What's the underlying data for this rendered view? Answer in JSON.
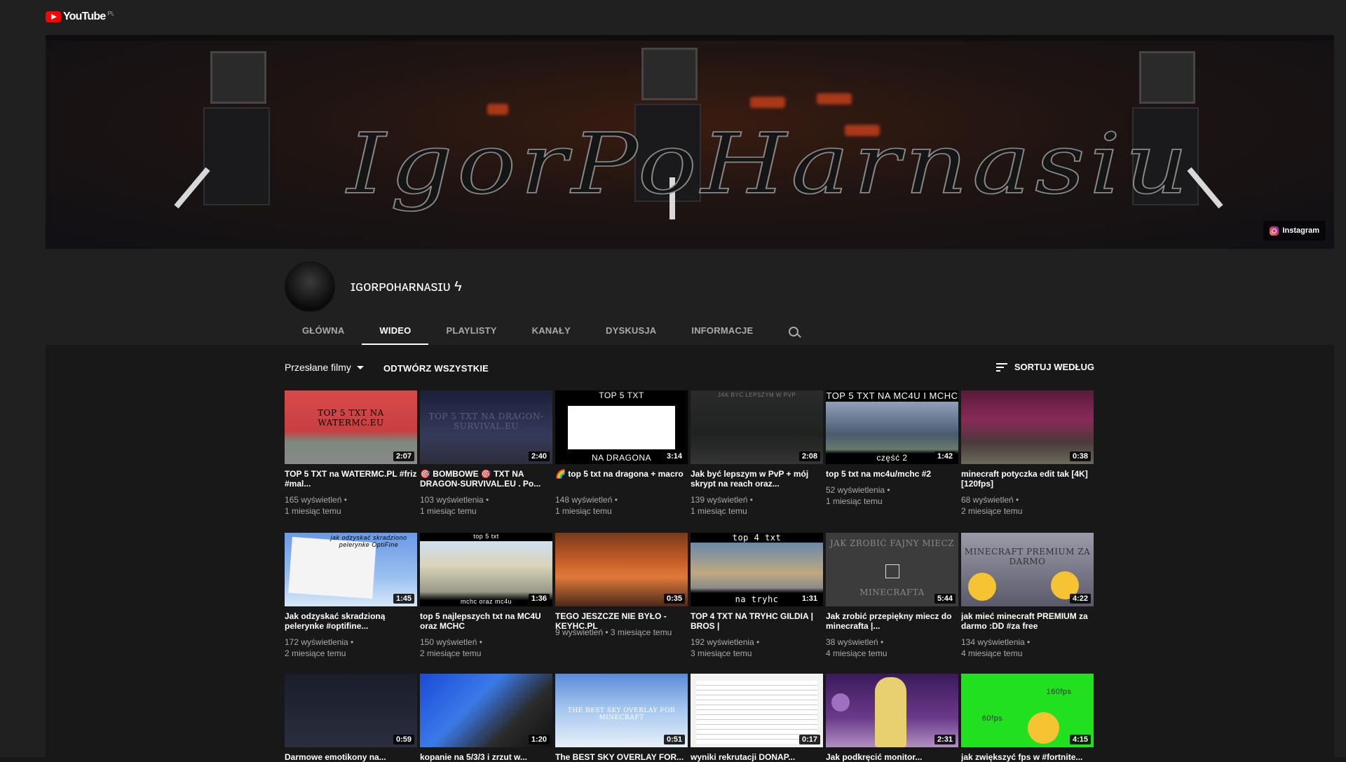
{
  "app": {
    "logo_text": "YouTube",
    "country": "PL"
  },
  "banner": {
    "title": "IgorPoHarnasiu",
    "link_label": "Instagram"
  },
  "channel": {
    "name": "ɪɢᴏʀᴘᴏʜᴀʀɴᴀsɪᴜ ϟ"
  },
  "tabs": [
    {
      "label": "GŁÓWNA"
    },
    {
      "label": "WIDEO",
      "active": true
    },
    {
      "label": "PLAYLISTY"
    },
    {
      "label": "KANAŁY"
    },
    {
      "label": "DYSKUSJA"
    },
    {
      "label": "INFORMACJE"
    }
  ],
  "filter": {
    "uploads_label": "Przesłane filmy",
    "play_all_label": "ODTWÓRZ WSZYSTKIE",
    "sort_label": "SORTUJ WEDŁUG"
  },
  "videos": [
    {
      "title": "TOP 5 TXT na WATERMC.PL #friz #mal...",
      "views": "165 wyświetleń",
      "age": "1 miesiąc temu",
      "duration": "2:07",
      "thumb_text": "TOP 5 TXT NA WATERMC.EU"
    },
    {
      "title": "🎯 BOMBOWE 🎯 TXT NA DRAGON-SURVIVAL.EU . Po...",
      "views": "103 wyświetlenia",
      "age": "1 miesiąc temu",
      "duration": "2:40",
      "thumb_text": "TOP 5 TXT NA DRAGON-SURVIVAL.EU"
    },
    {
      "title": "🌈 top 5 txt na dragona + macro",
      "views": "148 wyświetleń",
      "age": "1 miesiąc temu",
      "duration": "3:14",
      "thumb_text": "TOP 5 TXT",
      "thumb_text2": "NA DRAGONA"
    },
    {
      "title": "Jak być lepszym w PvP + mój skrypt na reach oraz...",
      "views": "139 wyświetleń",
      "age": "1 miesiąc temu",
      "duration": "2:08",
      "thumb_text": "JAK BYĆ LEPSZYM W PVP"
    },
    {
      "title": "top 5 txt na mc4u/mchc #2",
      "views": "52 wyświetlenia",
      "age": "1 miesiąc temu",
      "duration": "1:42",
      "thumb_text": "TOP 5 TXT NA MC4U I MCHC",
      "thumb_text2": "część 2"
    },
    {
      "title": "minecraft potyczka edit tak [4K] [120fps]",
      "views": "68 wyświetleń",
      "age": "2 miesiące temu",
      "duration": "0:38"
    },
    {
      "title": "Jak odzyskać skradzioną pelerynke #optifine...",
      "views": "172 wyświetlenia",
      "age": "2 miesiące temu",
      "duration": "1:45",
      "thumb_text": "jak odzyskać skradziono pelerynke OptiFine"
    },
    {
      "title": "top 5 najlepszych txt na MC4U oraz MCHC",
      "views": "150 wyświetleń",
      "age": "2 miesiące temu",
      "duration": "1:36",
      "thumb_text": "top 5 txt",
      "thumb_text2": "mchc oraz mc4u"
    },
    {
      "title": "TEGO JESZCZE NIE BYŁO - KEYHC.PL",
      "views": "9 wyświetleń",
      "age": "3 miesiące temu",
      "duration": "0:35"
    },
    {
      "title": "TOP 4 TXT NA TRYHC GILDIA | BROS |",
      "views": "192 wyświetlenia",
      "age": "3 miesiące temu",
      "duration": "1:31",
      "thumb_text": "top 4 txt",
      "thumb_text2": "na tryhc"
    },
    {
      "title": "Jak zrobić przepiękny miecz do minecrafta |...",
      "views": "38 wyświetleń",
      "age": "4 miesiące temu",
      "duration": "5:44",
      "thumb_text": "JAK ZROBIĆ FAJNY MIECZ",
      "thumb_text2": "MINECRAFTA"
    },
    {
      "title": "jak mieć minecraft PREMIUM za darmo :DD #za free",
      "views": "134 wyświetlenia",
      "age": "4 miesiące temu",
      "duration": "4:22",
      "thumb_text": "MINECRAFT PREMIUM ZA DARMO"
    },
    {
      "title": "Darmowe emotikony na...",
      "views": "",
      "age": "",
      "duration": "0:59"
    },
    {
      "title": "kopanie na 5/3/3 i zrzut w...",
      "views": "",
      "age": "",
      "duration": "1:20"
    },
    {
      "title": "The BEST SKY OVERLAY FOR...",
      "views": "",
      "age": "",
      "duration": "0:51",
      "thumb_text": "THE BEST SKY OVERLAY FOR MINECRAFT"
    },
    {
      "title": "wyniki rekrutacji DONAP...",
      "views": "",
      "age": "",
      "duration": "0:17"
    },
    {
      "title": "Jak podkręcić monitor...",
      "views": "",
      "age": "",
      "duration": "2:31"
    },
    {
      "title": "jak zwiększyć fps w #fortnite...",
      "views": "",
      "age": "",
      "duration": "4:15",
      "thumb_text": "60fps",
      "thumb_text2": "160fps"
    }
  ],
  "colors": {
    "background": "#181818",
    "surface": "#202020",
    "accent": "#ff0000",
    "text_secondary": "#aaaaaa"
  }
}
